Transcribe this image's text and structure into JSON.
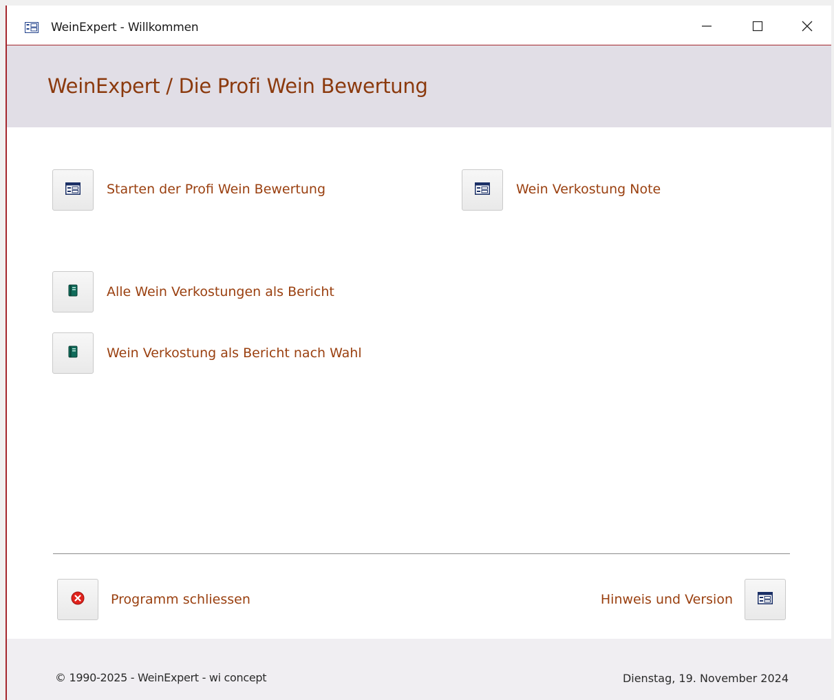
{
  "window": {
    "title": "WeinExpert -  Willkommen",
    "app_icon": "form-icon",
    "controls": [
      "minimize-icon",
      "maximize-icon",
      "close-icon"
    ]
  },
  "header": {
    "title": "WeinExpert / Die Profi Wein Bewertung"
  },
  "menu": {
    "start_rating": {
      "label": "Starten der Profi Wein Bewertung",
      "icon": "form-icon"
    },
    "tasting_note": {
      "label": "Wein Verkostung Note",
      "icon": "form-icon"
    },
    "all_tastings_report": {
      "label": "Alle Wein Verkostungen als Bericht",
      "icon": "report-icon"
    },
    "tasting_report_choice": {
      "label": "Wein Verkostung als Bericht nach Wahl",
      "icon": "report-icon"
    }
  },
  "bottom": {
    "close_program": {
      "label": "Programm schliessen",
      "icon": "close-circle-icon"
    },
    "info_version": {
      "label": "Hinweis und Version",
      "icon": "form-icon"
    }
  },
  "footer": {
    "copyright": "© 1990-2025 - WeinExpert - wi concept",
    "date": "Dienstag, 19. November 2024"
  },
  "colors": {
    "accent": "#8b3a0e",
    "header_bg": "#e1dee6",
    "footer_bg": "#f0eef2",
    "window_border": "#a4262c"
  }
}
